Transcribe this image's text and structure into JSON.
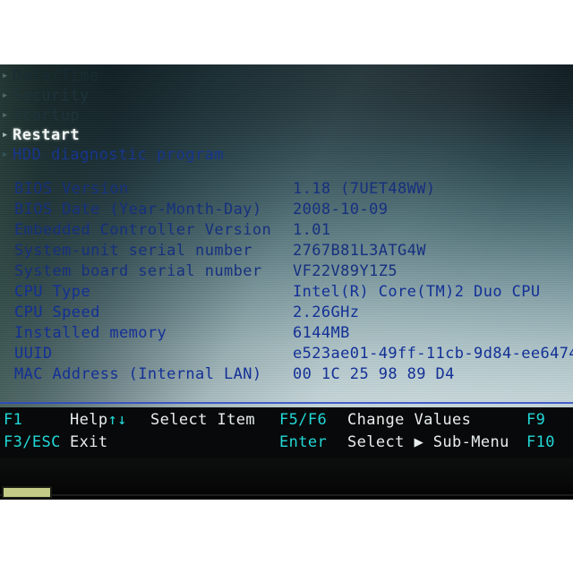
{
  "screen": {
    "menu_items": [
      {
        "label": "Date/Time",
        "state": "dim",
        "marker": "▸"
      },
      {
        "label": "Security",
        "state": "dim",
        "marker": "▸"
      },
      {
        "label": "Startup",
        "state": "dim",
        "marker": "▸"
      },
      {
        "label": "Restart",
        "state": "selected",
        "marker": "▸"
      },
      {
        "label": "HDD diagnostic program",
        "state": "normal",
        "marker": "▸"
      }
    ],
    "info_rows": [
      {
        "label": "BIOS Version",
        "value": "1.18   (7UET48WW)"
      },
      {
        "label": "BIOS Date (Year-Month-Day)",
        "value": "2008-10-09"
      },
      {
        "label": "Embedded Controller Version",
        "value": "1.01"
      },
      {
        "label": "System-unit serial number",
        "value": "2767B81L3ATG4W"
      },
      {
        "label": "System board serial number",
        "value": "VF22V89Y1Z5"
      },
      {
        "label": "CPU Type",
        "value": "Intel(R) Core(TM)2 Duo CPU"
      },
      {
        "label": "CPU Speed",
        "value": "2.26GHz"
      },
      {
        "label": "Installed memory",
        "value": "6144MB"
      },
      {
        "label": "UUID",
        "value": "e523ae01-49ff-11cb-9d84-ee6474"
      },
      {
        "label": "MAC Address (Internal LAN)",
        "value": "00 1C 25 98 89 D4"
      }
    ],
    "footer": {
      "row1": {
        "key1": "F1",
        "desc1": "Help",
        "arrows": "↑↓",
        "desc2": "Select Item",
        "key2": "F5/F6",
        "desc3": "Change Values",
        "key3": "F9"
      },
      "row2": {
        "key1": "F3/ESC",
        "desc1": "Exit",
        "key2": "Enter",
        "desc3_pre": "Select",
        "triangle": "▶",
        "desc3_post": "Sub-Menu",
        "key3": "F10"
      }
    }
  },
  "colors": {
    "text_blue": "#16307f",
    "selected_white": "#f2f6f4",
    "footer_key_cyan": "#23d7d7",
    "footer_desc_white": "#e8eeec",
    "rule_blue": "#2b49c9",
    "footer_bg": "#07090a",
    "sticker": "#c3cb86"
  }
}
